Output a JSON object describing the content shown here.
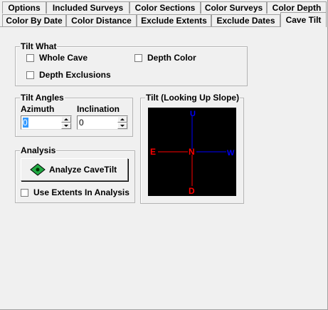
{
  "tabs_row1": [
    "Options",
    "Included Surveys",
    "Color Sections",
    "Color Surveys",
    "Color Depth"
  ],
  "tabs_row2": [
    "Color By Date",
    "Color Distance",
    "Exclude Extents",
    "Exclude Dates",
    "Cave Tilt"
  ],
  "active_tab": "Cave Tilt",
  "tilt_what": {
    "title": "Tilt What",
    "whole_cave": "Whole Cave",
    "depth_color": "Depth Color",
    "depth_exclusions": "Depth Exclusions"
  },
  "tilt_angles": {
    "title": "Tilt Angles",
    "azimuth_label": "Azimuth",
    "azimuth_value": "0",
    "inclination_label": "Inclination",
    "inclination_value": "0"
  },
  "tilt_view": {
    "title": "Tilt (Looking Up Slope)",
    "up": "U",
    "down": "D",
    "east": "E",
    "west": "W",
    "north": "N",
    "colors": {
      "background": "#000000",
      "vertical_up": "#0000ff",
      "horizontal_east": "#ff0000",
      "horizontal_west": "#0000ff",
      "vertical_down": "#ff0000",
      "north": "#ff0000"
    }
  },
  "analysis": {
    "title": "Analysis",
    "analyze_button": "Analyze CaveTilt",
    "use_extents": "Use Extents In Analysis"
  }
}
